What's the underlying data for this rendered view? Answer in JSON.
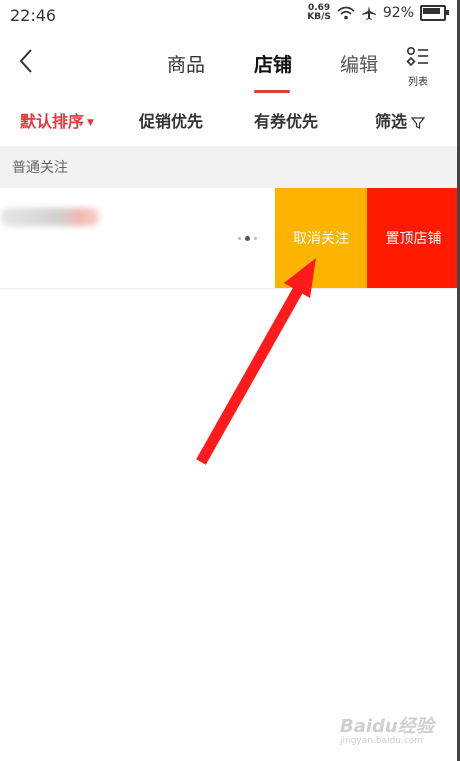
{
  "status_bar": {
    "time": "22:46",
    "net_speed_value": "0.69",
    "net_speed_unit": "KB/S",
    "battery": "92%"
  },
  "nav": {
    "tabs": [
      {
        "label": "商品"
      },
      {
        "label": "店铺"
      },
      {
        "label": "编辑"
      }
    ],
    "active_tab_index": 1,
    "list_toggle_label": "列表"
  },
  "filters": [
    {
      "label": "默认排序"
    },
    {
      "label": "促销优先"
    },
    {
      "label": "有券优先"
    },
    {
      "label": "筛选"
    }
  ],
  "section": {
    "title": "普通关注"
  },
  "shop_row": {
    "unfollow_label": "取消关注",
    "pin_label": "置顶店铺"
  },
  "watermark": {
    "brand": "Baidu经验",
    "url": "jingyan.baidu.com"
  },
  "colors": {
    "accent": "#e4393c",
    "unfollow": "#fdb400",
    "pin": "#ff1a00",
    "arrow": "#ff1b1b"
  }
}
